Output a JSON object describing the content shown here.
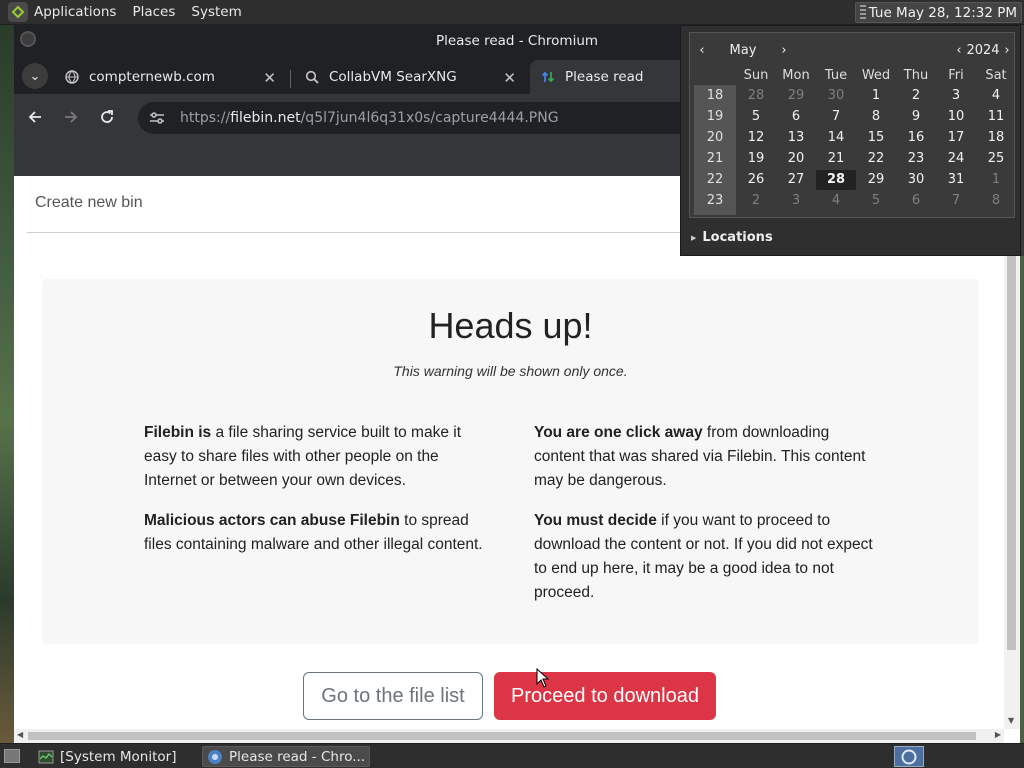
{
  "top_panel": {
    "menus": [
      "Applications",
      "Places",
      "System"
    ],
    "clock": "Tue May 28, 12:32 PM"
  },
  "window": {
    "title": "Please read - Chromium"
  },
  "tabs": [
    {
      "label": "compternewb.com",
      "icon": "globe-icon"
    },
    {
      "label": "CollabVM SearXNG",
      "icon": "searxng-icon"
    },
    {
      "label": "Please read",
      "icon": "filebin-icon",
      "active": true
    }
  ],
  "omnibox": {
    "scheme": "https://",
    "host": "filebin.net",
    "path": "/q5l7jun4l6q31x0s/capture4444.PNG"
  },
  "page": {
    "create_link": "Create new bin",
    "heading": "Heads up!",
    "subtitle": "This warning will be shown only once.",
    "left_col": [
      {
        "bold": "Filebin is",
        "text": " a file sharing service built to make it easy to share files with other people on the Internet or between your own devices."
      },
      {
        "bold": "Malicious actors can abuse Filebin",
        "text": " to spread files containing malware and other illegal content."
      }
    ],
    "right_col": [
      {
        "bold": "You are one click away",
        "text": " from downloading content that was shared via Filebin. This content may be dangerous."
      },
      {
        "bold": "You must decide",
        "text": " if you want to proceed to download the content or not. If you did not expect to end up here, it may be a good idea to not proceed."
      }
    ],
    "buttons": {
      "file_list": "Go to the file list",
      "proceed": "Proceed to download"
    }
  },
  "calendar": {
    "month": "May",
    "year": "2024",
    "weekdays": [
      "Sun",
      "Mon",
      "Tue",
      "Wed",
      "Thu",
      "Fri",
      "Sat"
    ],
    "week_numbers": [
      "18",
      "19",
      "20",
      "21",
      "22",
      "23"
    ],
    "days": [
      [
        [
          "28",
          "dim"
        ],
        [
          "29",
          "dim"
        ],
        [
          "30",
          "dim"
        ],
        [
          "1",
          ""
        ],
        [
          "2",
          ""
        ],
        [
          "3",
          ""
        ],
        [
          "4",
          ""
        ]
      ],
      [
        [
          "5",
          ""
        ],
        [
          "6",
          ""
        ],
        [
          "7",
          ""
        ],
        [
          "8",
          ""
        ],
        [
          "9",
          ""
        ],
        [
          "10",
          ""
        ],
        [
          "11",
          ""
        ]
      ],
      [
        [
          "12",
          ""
        ],
        [
          "13",
          ""
        ],
        [
          "14",
          ""
        ],
        [
          "15",
          ""
        ],
        [
          "16",
          ""
        ],
        [
          "17",
          ""
        ],
        [
          "18",
          ""
        ]
      ],
      [
        [
          "19",
          ""
        ],
        [
          "20",
          ""
        ],
        [
          "21",
          ""
        ],
        [
          "22",
          ""
        ],
        [
          "23",
          ""
        ],
        [
          "24",
          ""
        ],
        [
          "25",
          ""
        ]
      ],
      [
        [
          "26",
          ""
        ],
        [
          "27",
          ""
        ],
        [
          "28",
          "today"
        ],
        [
          "29",
          ""
        ],
        [
          "30",
          ""
        ],
        [
          "31",
          ""
        ],
        [
          "1",
          "dim"
        ]
      ],
      [
        [
          "2",
          "dim"
        ],
        [
          "3",
          "dim"
        ],
        [
          "4",
          "dim"
        ],
        [
          "5",
          "dim"
        ],
        [
          "6",
          "dim"
        ],
        [
          "7",
          "dim"
        ],
        [
          "8",
          "dim"
        ]
      ]
    ],
    "locations_label": "Locations"
  },
  "taskbar": {
    "tasks": [
      {
        "label": "[System Monitor]",
        "icon": "system-monitor-icon"
      },
      {
        "label": "Please read - Chro...",
        "icon": "chromium-icon",
        "active": true
      }
    ]
  },
  "colors": {
    "accent_danger": "#dc3545",
    "card_bg": "#f7f7f8",
    "chrome_dark": "#202124"
  }
}
